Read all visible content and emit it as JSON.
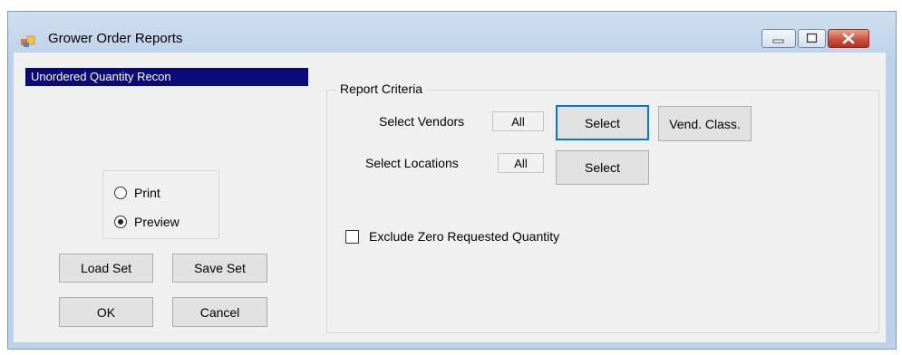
{
  "window": {
    "title": "Grower Order Reports",
    "icon": "app-window-icon",
    "controls": [
      "minimize-icon",
      "maximize-icon",
      "close-icon"
    ]
  },
  "report_list": {
    "items": [
      "Unordered Quantity Recon"
    ],
    "selected": "Unordered Quantity Recon"
  },
  "output": {
    "print_label": "Print",
    "preview_label": "Preview",
    "selected": "Preview"
  },
  "buttons": {
    "load_set": "Load Set",
    "save_set": "Save Set",
    "ok": "OK",
    "cancel": "Cancel"
  },
  "criteria": {
    "group_label": "Report Criteria",
    "vendors_label": "Select Vendors",
    "vendors_value": "All",
    "vendors_select": "Select",
    "vend_class": "Vend. Class.",
    "locations_label": "Select Locations",
    "locations_value": "All",
    "locations_select": "Select",
    "exclude_zero_label": "Exclude Zero Requested Quantity",
    "exclude_zero_checked": false
  },
  "colors": {
    "selection": "#0a0a78",
    "focus": "#0078d7",
    "close_button": "#c8553f"
  }
}
